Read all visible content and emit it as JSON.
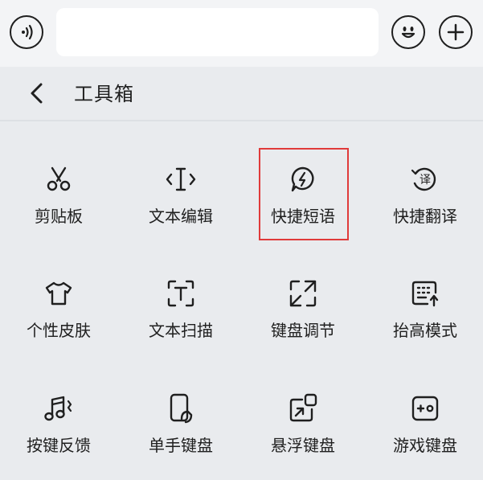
{
  "header": {
    "voice_icon": "voice-wave-icon",
    "emoji_icon": "emoji-smile-icon",
    "plus_icon": "plus-icon"
  },
  "toolbox": {
    "title": "工具箱",
    "back_icon": "chevron-left-icon",
    "items": [
      {
        "label": "剪贴板",
        "icon": "scissors-icon"
      },
      {
        "label": "文本编辑",
        "icon": "text-cursor-icon"
      },
      {
        "label": "快捷短语",
        "icon": "flash-bubble-icon",
        "highlighted": true
      },
      {
        "label": "快捷翻译",
        "icon": "translate-icon"
      },
      {
        "label": "个性皮肤",
        "icon": "tshirt-icon"
      },
      {
        "label": "文本扫描",
        "icon": "scan-text-icon"
      },
      {
        "label": "键盘调节",
        "icon": "resize-arrows-icon"
      },
      {
        "label": "抬高模式",
        "icon": "keyboard-raise-icon"
      },
      {
        "label": "按键反馈",
        "icon": "music-feedback-icon"
      },
      {
        "label": "单手键盘",
        "icon": "one-hand-phone-icon"
      },
      {
        "label": "悬浮键盘",
        "icon": "floating-keyboard-icon"
      },
      {
        "label": "游戏键盘",
        "icon": "game-keyboard-icon"
      }
    ]
  },
  "colors": {
    "highlight": "#e03a3a",
    "background": "#e9ebee"
  }
}
